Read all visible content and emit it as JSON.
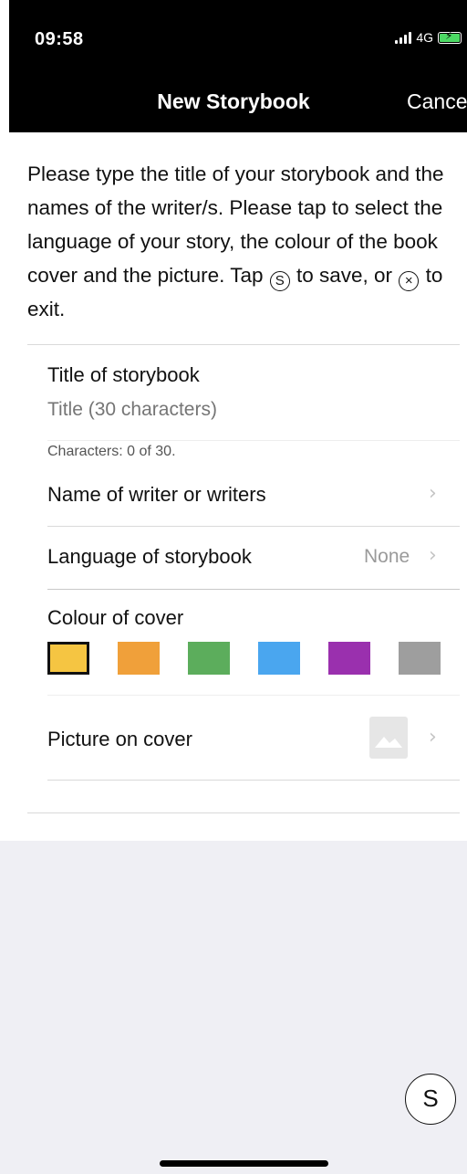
{
  "status": {
    "time": "09:58",
    "network": "4G"
  },
  "nav": {
    "title": "New Storybook",
    "cancel": "Cancel"
  },
  "intro": {
    "part1": "Please type the title of your storybook and the names of the writer/s. Please tap to select the language of your story, the colour of the book cover and the picture. Tap ",
    "save_symbol": "S",
    "part2": " to save, or ",
    "exit_symbol": "×",
    "part3": " to exit."
  },
  "form": {
    "title_label": "Title of storybook",
    "title_placeholder": "Title (30 characters)",
    "char_count": "Characters: 0 of 30.",
    "writer_label": "Name of writer or writers",
    "language_label": "Language of storybook",
    "language_value": "None",
    "colour_label": "Colour of cover",
    "colours": [
      {
        "name": "yellow",
        "hex": "#f5c542",
        "selected": true
      },
      {
        "name": "orange",
        "hex": "#f0a03a",
        "selected": false
      },
      {
        "name": "green",
        "hex": "#5cad5c",
        "selected": false
      },
      {
        "name": "blue",
        "hex": "#4aa6ef",
        "selected": false
      },
      {
        "name": "purple",
        "hex": "#9a30ae",
        "selected": false
      },
      {
        "name": "grey",
        "hex": "#9e9e9e",
        "selected": false
      }
    ],
    "picture_label": "Picture on cover",
    "chevron": "›"
  },
  "save_button": "S",
  "icons": [
    "signal-icon",
    "battery-icon",
    "chevron-right-icon",
    "image-placeholder-icon",
    "save-circle-icon"
  ]
}
